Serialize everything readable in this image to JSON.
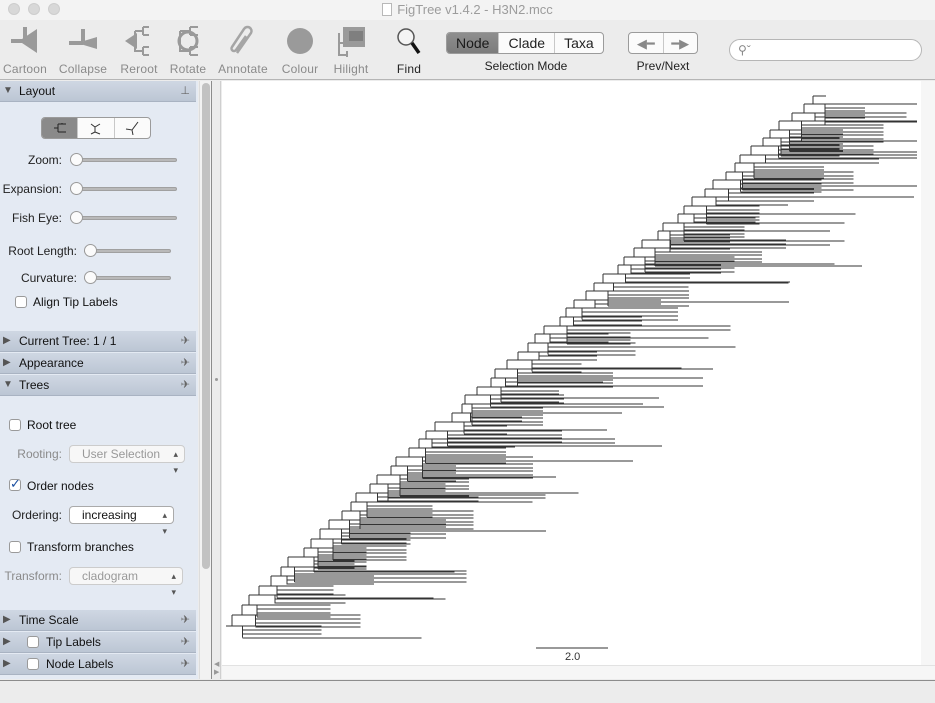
{
  "window": {
    "title": "FigTree v1.4.2 - H3N2.mcc"
  },
  "toolbar": {
    "tools": [
      {
        "label": "Cartoon",
        "icon": "cartoon-icon",
        "enabled": false
      },
      {
        "label": "Collapse",
        "icon": "collapse-icon",
        "enabled": false
      },
      {
        "label": "Reroot",
        "icon": "reroot-icon",
        "enabled": false
      },
      {
        "label": "Rotate",
        "icon": "rotate-icon",
        "enabled": false
      },
      {
        "label": "Annotate",
        "icon": "paperclip-icon",
        "enabled": false
      },
      {
        "label": "Colour",
        "icon": "colour-circle-icon",
        "enabled": false
      },
      {
        "label": "Hilight",
        "icon": "hilight-icon",
        "enabled": false
      },
      {
        "label": "Find",
        "icon": "magnifier-icon",
        "enabled": true
      }
    ],
    "selection_mode": {
      "label": "Selection Mode",
      "options": [
        "Node",
        "Clade",
        "Taxa"
      ],
      "selected": "Node"
    },
    "prev_next": {
      "label": "Prev/Next",
      "prev_icon": "arrow-left-icon",
      "next_icon": "arrow-right-icon"
    },
    "search": {
      "value": "",
      "placeholder": ""
    }
  },
  "panel": {
    "layout": {
      "title": "Layout",
      "expanded": true,
      "layout_types": [
        "rectangular",
        "polar",
        "radial"
      ],
      "selected_layout": "rectangular",
      "sliders": [
        {
          "label": "Zoom:",
          "value": 0
        },
        {
          "label": "Expansion:",
          "value": 0
        },
        {
          "label": "Fish Eye:",
          "value": 0
        },
        {
          "label": "Root Length:",
          "value": 0
        },
        {
          "label": "Curvature:",
          "value": 0
        }
      ],
      "align_tip_labels": {
        "label": "Align Tip Labels",
        "checked": false
      }
    },
    "current_tree": {
      "title": "Current Tree: 1 / 1",
      "expanded": false
    },
    "appearance": {
      "title": "Appearance",
      "expanded": false
    },
    "trees": {
      "title": "Trees",
      "expanded": true,
      "root_tree": {
        "label": "Root tree",
        "checked": false
      },
      "rooting": {
        "label": "Rooting:",
        "value": "User Selection",
        "enabled": false
      },
      "order_nodes": {
        "label": "Order nodes",
        "checked": true
      },
      "ordering": {
        "label": "Ordering:",
        "value": "increasing",
        "enabled": true
      },
      "transform_branches": {
        "label": "Transform branches",
        "checked": false
      },
      "transform": {
        "label": "Transform:",
        "value": "cladogram",
        "enabled": false
      }
    },
    "time_scale": {
      "title": "Time Scale",
      "expanded": false
    },
    "tip_labels": {
      "title": "Tip Labels",
      "expanded": false,
      "checked": false
    },
    "node_labels": {
      "title": "Node Labels",
      "expanded": false,
      "checked": false
    }
  },
  "tree_view": {
    "scale_bar_label": "2.0"
  }
}
